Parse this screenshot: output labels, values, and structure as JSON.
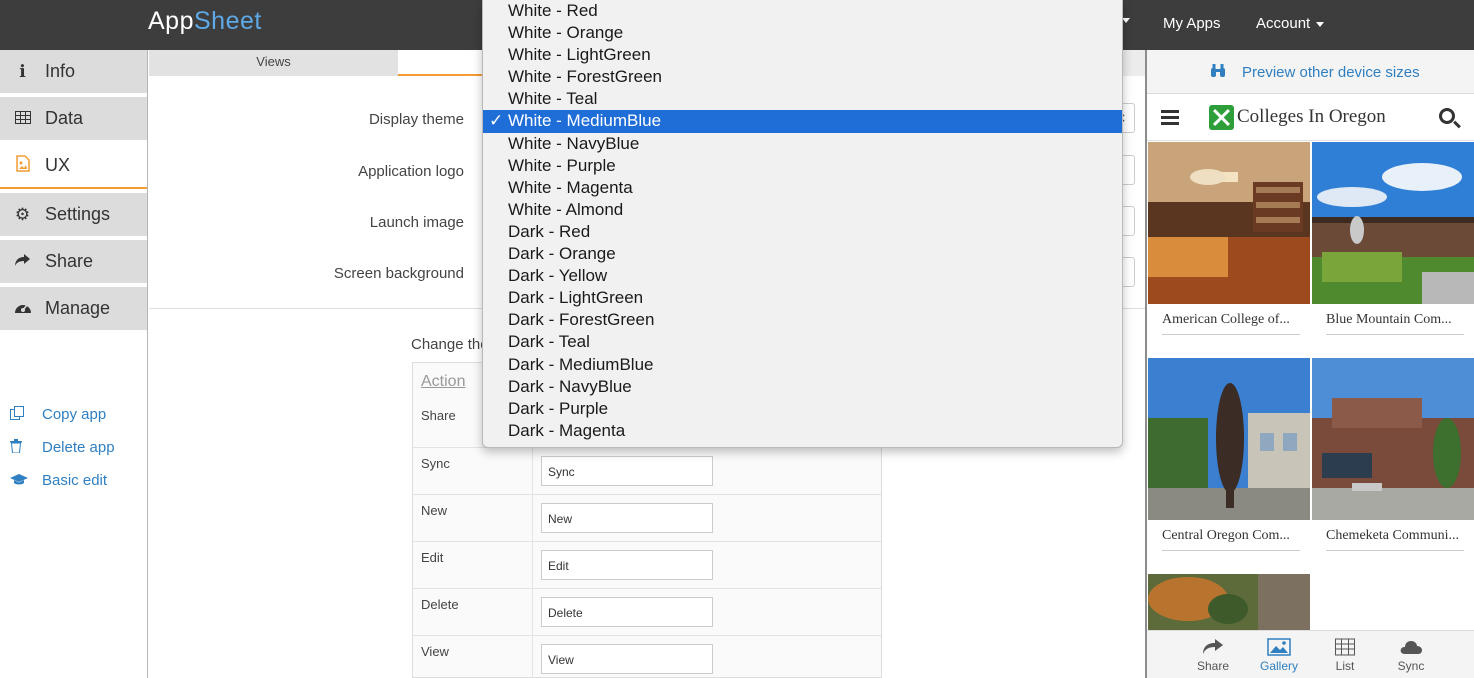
{
  "topbar": {
    "logo_app": "App",
    "logo_sheet": "Sheet",
    "my_apps": "My Apps",
    "account": "Account"
  },
  "sidebar": {
    "items": [
      {
        "label": "Info",
        "icon": "info-icon"
      },
      {
        "label": "Data",
        "icon": "table-icon"
      },
      {
        "label": "UX",
        "icon": "image-file-icon"
      },
      {
        "label": "Settings",
        "icon": "gear-icon"
      },
      {
        "label": "Share",
        "icon": "share-arrow-icon"
      },
      {
        "label": "Manage",
        "icon": "dashboard-icon"
      }
    ],
    "active": "UX",
    "links": [
      {
        "label": "Copy app",
        "icon": "copy-icon"
      },
      {
        "label": "Delete app",
        "icon": "trash-icon"
      },
      {
        "label": "Basic edit",
        "icon": "graduation-cap-icon"
      }
    ]
  },
  "main": {
    "tabs": {
      "views": "Views"
    },
    "form": {
      "display_theme": "Display theme",
      "application_logo": "Application logo",
      "launch_image": "Launch image",
      "screen_background": "Screen background"
    },
    "change_text": "Change the",
    "actions": {
      "header": "Action",
      "rows": [
        {
          "label": "Share",
          "value": ""
        },
        {
          "label": "Sync",
          "value": "Sync"
        },
        {
          "label": "New",
          "value": "New"
        },
        {
          "label": "Edit",
          "value": "Edit"
        },
        {
          "label": "Delete",
          "value": "Delete"
        },
        {
          "label": "View",
          "value": "View"
        }
      ]
    }
  },
  "theme_dropdown": {
    "selected": "White - MediumBlue",
    "options": [
      "White - Red",
      "White - Orange",
      "White - LightGreen",
      "White - ForestGreen",
      "White - Teal",
      "White - MediumBlue",
      "White - NavyBlue",
      "White - Purple",
      "White - Magenta",
      "White - Almond",
      "Dark - Red",
      "Dark - Orange",
      "Dark - Yellow",
      "Dark - LightGreen",
      "Dark - ForestGreen",
      "Dark - Teal",
      "Dark - MediumBlue",
      "Dark - NavyBlue",
      "Dark - Purple",
      "Dark - Magenta"
    ]
  },
  "preview": {
    "other_sizes": "Preview other device sizes",
    "app_title": "Colleges In Oregon",
    "tiles": [
      "American College of...",
      "Blue Mountain Com...",
      "Central Oregon Com...",
      "Chemeketa Communi..."
    ],
    "bottom_nav": [
      {
        "label": "Share",
        "icon": "share-arrow-icon"
      },
      {
        "label": "Gallery",
        "icon": "gallery-icon"
      },
      {
        "label": "List",
        "icon": "table-icon"
      },
      {
        "label": "Sync",
        "icon": "cloud-icon"
      }
    ],
    "active_nav": "Gallery"
  },
  "colors": {
    "topbar": "#3d3d3d",
    "accent_orange": "#f39c34",
    "link_blue": "#2f7fc1",
    "selection_blue": "#1f6ed8"
  }
}
